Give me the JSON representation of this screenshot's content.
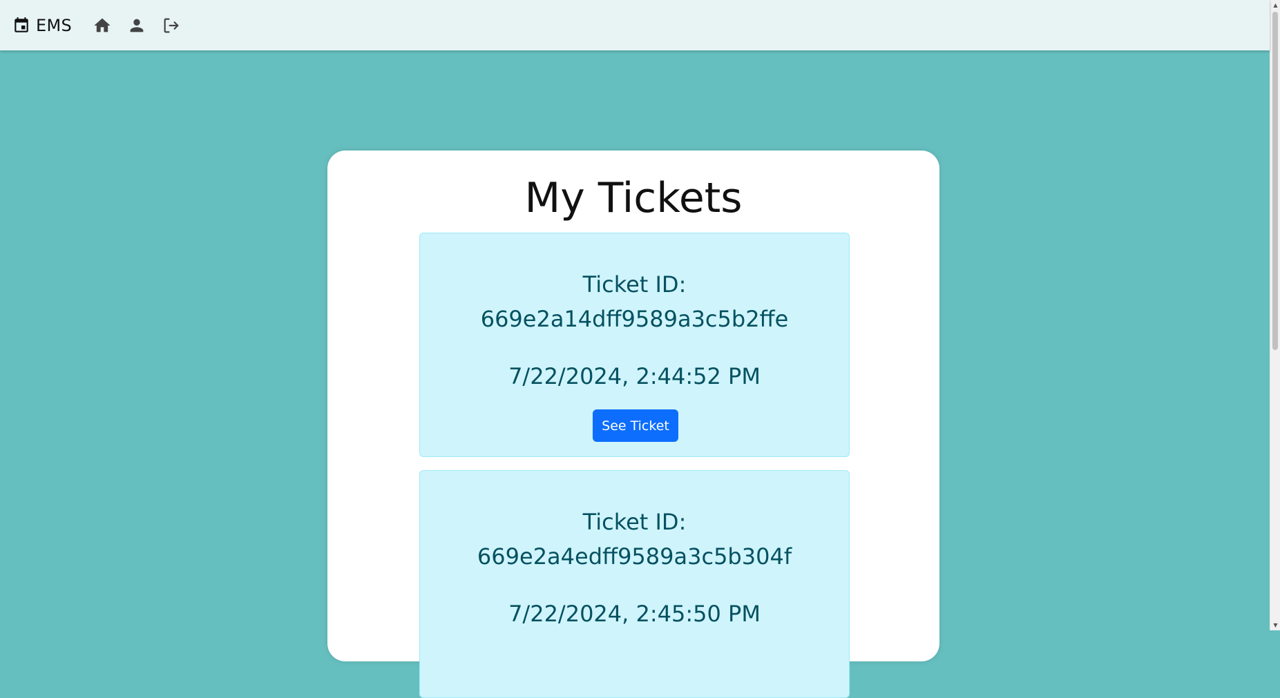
{
  "navbar": {
    "brand_text": "EMS",
    "brand_icon": "calendar-icon",
    "icons": [
      "home-icon",
      "person-icon",
      "logout-icon"
    ]
  },
  "main": {
    "title": "My Tickets",
    "tickets": [
      {
        "label": "Ticket ID:",
        "id": "669e2a14dff9589a3c5b2ffe",
        "date": "7/22/2024, 2:44:52 PM",
        "button_label": "See Ticket"
      },
      {
        "label": "Ticket ID:",
        "id": "669e2a4edff9589a3c5b304f",
        "date": "7/22/2024, 2:45:50 PM"
      }
    ]
  },
  "colors": {
    "background": "#66bfbf",
    "navbar": "#e8f4f4",
    "ticket_bg": "#cff4fc",
    "ticket_text": "#055160",
    "button": "#0d6efd"
  }
}
